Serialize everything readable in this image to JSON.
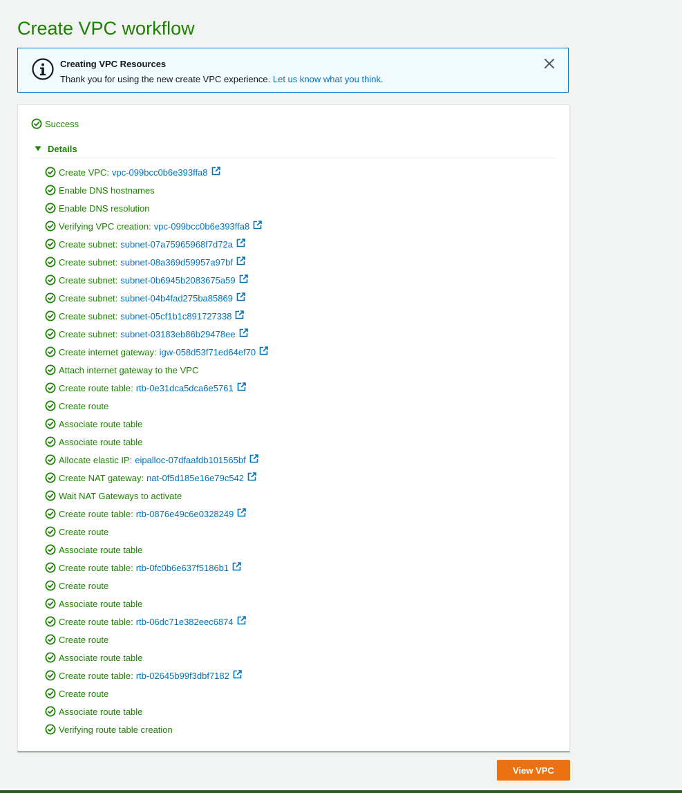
{
  "page": {
    "title": "Create VPC workflow"
  },
  "flash": {
    "title": "Creating VPC Resources",
    "message": "Thank you for using the new create VPC experience.",
    "link_text": "Let us know what you think.",
    "icon": "info-icon",
    "close_icon": "close-icon"
  },
  "status": {
    "label": "Success",
    "icon": "check-circle-icon"
  },
  "details": {
    "label": "Details",
    "expanded": true,
    "steps": [
      {
        "label": "Create VPC:",
        "resource": "vpc-099bcc0b6e393ffa8"
      },
      {
        "label": "Enable DNS hostnames"
      },
      {
        "label": "Enable DNS resolution"
      },
      {
        "label": "Verifying VPC creation:",
        "resource": "vpc-099bcc0b6e393ffa8"
      },
      {
        "label": "Create subnet:",
        "resource": "subnet-07a75965968f7d72a"
      },
      {
        "label": "Create subnet:",
        "resource": "subnet-08a369d59957a97bf"
      },
      {
        "label": "Create subnet:",
        "resource": "subnet-0b6945b2083675a59"
      },
      {
        "label": "Create subnet:",
        "resource": "subnet-04b4fad275ba85869"
      },
      {
        "label": "Create subnet:",
        "resource": "subnet-05cf1b1c891727338"
      },
      {
        "label": "Create subnet:",
        "resource": "subnet-03183eb86b29478ee"
      },
      {
        "label": "Create internet gateway:",
        "resource": "igw-058d53f71ed64ef70"
      },
      {
        "label": "Attach internet gateway to the VPC"
      },
      {
        "label": "Create route table:",
        "resource": "rtb-0e31dca5dca6e5761"
      },
      {
        "label": "Create route"
      },
      {
        "label": "Associate route table"
      },
      {
        "label": "Associate route table"
      },
      {
        "label": "Allocate elastic IP:",
        "resource": "eipalloc-07dfaafdb101565bf"
      },
      {
        "label": "Create NAT gateway:",
        "resource": "nat-0f5d185e16e79c542"
      },
      {
        "label": "Wait NAT Gateways to activate"
      },
      {
        "label": "Create route table:",
        "resource": "rtb-0876e49c6e0328249"
      },
      {
        "label": "Create route"
      },
      {
        "label": "Associate route table"
      },
      {
        "label": "Create route table:",
        "resource": "rtb-0fc0b6e637f5186b1"
      },
      {
        "label": "Create route"
      },
      {
        "label": "Associate route table"
      },
      {
        "label": "Create route table:",
        "resource": "rtb-06dc71e382eec6874"
      },
      {
        "label": "Create route"
      },
      {
        "label": "Associate route table"
      },
      {
        "label": "Create route table:",
        "resource": "rtb-02645b99f3dbf7182"
      },
      {
        "label": "Create route"
      },
      {
        "label": "Associate route table"
      },
      {
        "label": "Verifying route table creation"
      }
    ]
  },
  "actions": {
    "view_vpc_label": "View VPC"
  },
  "colors": {
    "success": "#1d8102",
    "link": "#0073bb",
    "info_border": "#0073bb",
    "info_background": "#f1faff",
    "primary_button": "#ec7211"
  }
}
